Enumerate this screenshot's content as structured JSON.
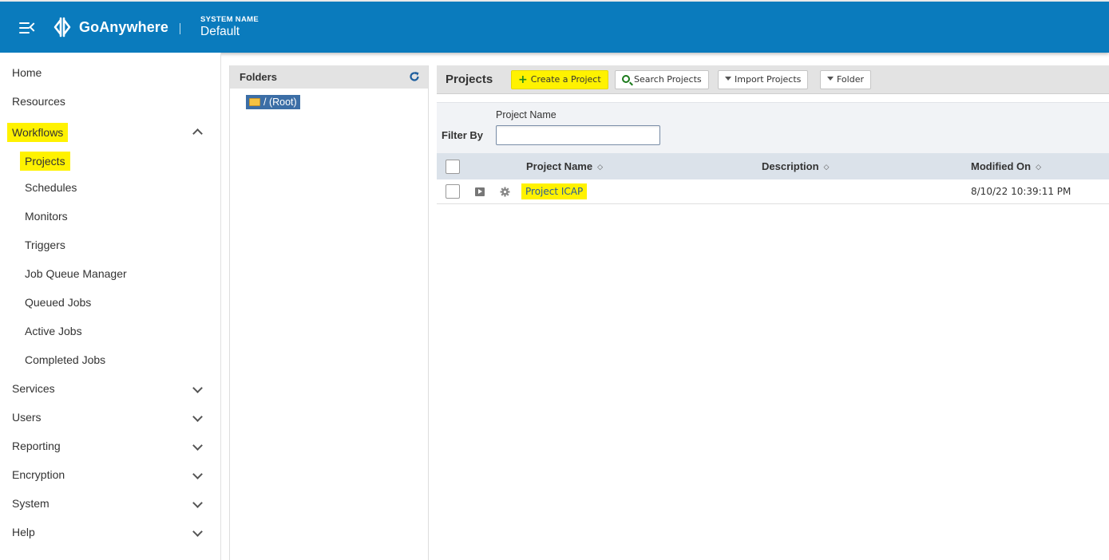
{
  "header": {
    "brand": "GoAnywhere",
    "system_name_label": "SYSTEM NAME",
    "system_name_value": "Default"
  },
  "sidebar": {
    "items": [
      {
        "label": "Home",
        "level": "top",
        "expandable": false
      },
      {
        "label": "Resources",
        "level": "top",
        "expandable": false
      },
      {
        "label": "Workflows",
        "level": "top",
        "expandable": true,
        "expanded": true,
        "highlighted": true
      },
      {
        "label": "Projects",
        "level": "sub",
        "highlighted": true
      },
      {
        "label": "Schedules",
        "level": "sub"
      },
      {
        "label": "Monitors",
        "level": "sub"
      },
      {
        "label": "Triggers",
        "level": "sub"
      },
      {
        "label": "Job Queue Manager",
        "level": "sub"
      },
      {
        "label": "Queued Jobs",
        "level": "sub"
      },
      {
        "label": "Active Jobs",
        "level": "sub"
      },
      {
        "label": "Completed Jobs",
        "level": "sub"
      },
      {
        "label": "Services",
        "level": "top",
        "expandable": true
      },
      {
        "label": "Users",
        "level": "top",
        "expandable": true
      },
      {
        "label": "Reporting",
        "level": "top",
        "expandable": true
      },
      {
        "label": "Encryption",
        "level": "top",
        "expandable": true
      },
      {
        "label": "System",
        "level": "top",
        "expandable": true
      },
      {
        "label": "Help",
        "level": "top",
        "expandable": true
      }
    ]
  },
  "folders": {
    "title": "Folders",
    "root_label": "/ (Root)"
  },
  "projects": {
    "title": "Projects",
    "buttons": {
      "create": "Create a Project",
      "search": "Search Projects",
      "import": "Import Projects",
      "folder": "Folder"
    },
    "filter": {
      "label": "Filter By",
      "column_label": "Project Name",
      "value": ""
    },
    "columns": {
      "name": "Project Name",
      "description": "Description",
      "modified": "Modified On"
    },
    "rows": [
      {
        "name": "Project ICAP",
        "description": "",
        "modified": "8/10/22 10:39:11 PM"
      }
    ]
  },
  "colors": {
    "header_blue": "#0a7bbd",
    "highlight_yellow": "#fff200",
    "selected_folder": "#3c6ea6",
    "table_header": "#dbe2ea"
  }
}
